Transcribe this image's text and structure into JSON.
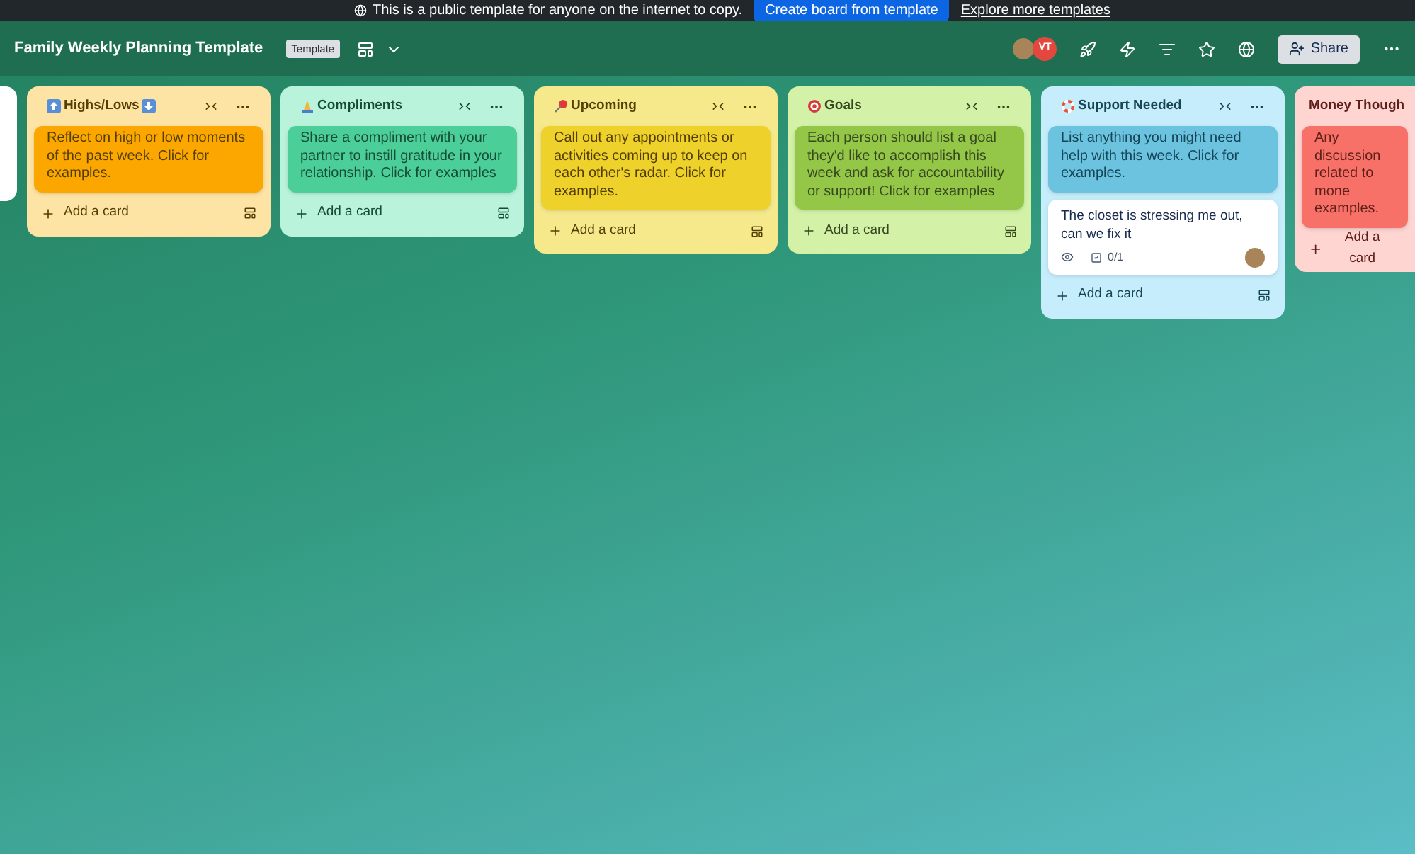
{
  "banner": {
    "message": "This is a public template for anyone on the internet to copy.",
    "primary_button": "Create board from template",
    "link": "Explore more templates"
  },
  "header": {
    "title": "Family Weekly Planning Template",
    "badge": "Template",
    "members": [
      {
        "kind": "photo"
      },
      {
        "kind": "initials",
        "initials": "VT",
        "color": "#e2483d"
      }
    ],
    "share_button": "Share"
  },
  "lists": [
    {
      "title": "Highs/Lows",
      "cards": [
        {
          "kind": "cover",
          "text": "Reflect on high or low moments of the past week. Click for examples."
        }
      ],
      "add_label": "Add a card"
    },
    {
      "title": "Compliments",
      "cards": [
        {
          "kind": "cover",
          "text": "Share a compliment with your partner to instill gratitude in your relationship. Click for examples"
        }
      ],
      "add_label": "Add a card"
    },
    {
      "title": "Upcoming",
      "cards": [
        {
          "kind": "cover",
          "text": "Call out any appointments or activities coming up to keep on each other's radar. Click for examples."
        }
      ],
      "add_label": "Add a card"
    },
    {
      "title": "Goals",
      "cards": [
        {
          "kind": "cover",
          "text": "Each person should list a goal they'd like to accomplish this week and ask for accountability or support! Click for examples"
        }
      ],
      "add_label": "Add a card"
    },
    {
      "title": "Support Needed",
      "cards": [
        {
          "kind": "cover",
          "text": "List anything you might need help with this week. Click for examples."
        },
        {
          "kind": "plain",
          "text": "The closet is stressing me out, can we fix it",
          "checklist": "0/1"
        }
      ],
      "add_label": "Add a card"
    },
    {
      "title": "Money Though",
      "cards": [
        {
          "kind": "cover",
          "text": "Any discussion related to mone examples."
        }
      ],
      "add_label": "Add a card"
    }
  ]
}
